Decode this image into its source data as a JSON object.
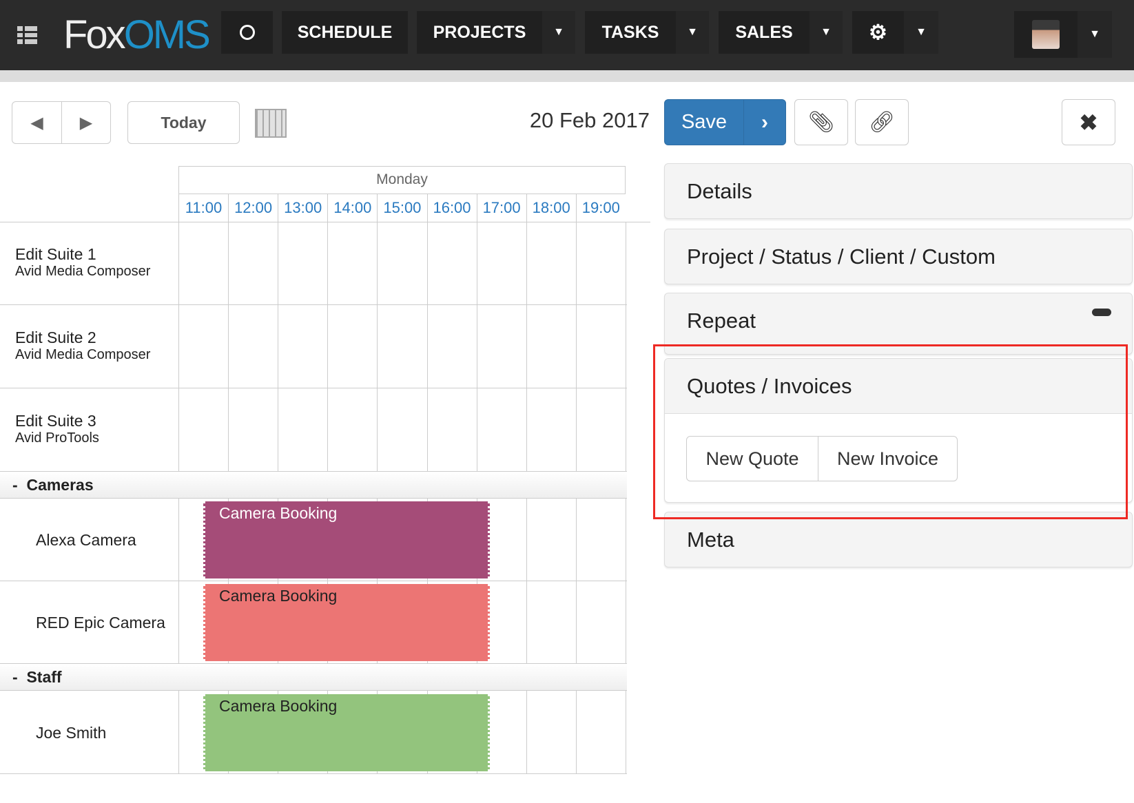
{
  "nav": {
    "brand_left": "Fox",
    "brand_right": "OMS",
    "items": [
      {
        "label": "SCHEDULE"
      },
      {
        "label": "PROJECTS"
      },
      {
        "label": "TASKS"
      },
      {
        "label": "SALES"
      }
    ],
    "colors": {
      "bar": "#2b2b2b",
      "brand_blue": "#1e90c8"
    }
  },
  "toolbar": {
    "today": "Today",
    "date": "20 Feb 2017",
    "save": "Save"
  },
  "calendar": {
    "day": "Monday",
    "hours": [
      "11:00",
      "12:00",
      "13:00",
      "14:00",
      "15:00",
      "16:00",
      "17:00",
      "18:00",
      "19:00"
    ],
    "rows": [
      {
        "name": "Edit Suite 1",
        "sub": "Avid Media Composer"
      },
      {
        "name": "Edit Suite 2",
        "sub": "Avid Media Composer"
      },
      {
        "name": "Edit Suite 3",
        "sub": "Avid ProTools"
      }
    ],
    "groups": [
      {
        "label": "Cameras",
        "toggle": "-",
        "rows": [
          {
            "name": "Alexa Camera"
          },
          {
            "name": "RED Epic Camera"
          }
        ]
      },
      {
        "label": "Staff",
        "toggle": "-",
        "rows": [
          {
            "name": "Joe Smith"
          }
        ]
      }
    ],
    "bookings": [
      {
        "title": "Camera Booking",
        "resource": "Alexa Camera",
        "color": "#a54c78",
        "text_color": "#ffffff"
      },
      {
        "title": "Camera Booking",
        "resource": "RED Epic Camera",
        "color": "#ec7574",
        "text_color": "#222222"
      },
      {
        "title": "Camera Booking",
        "resource": "Joe Smith",
        "color": "#93c47d",
        "text_color": "#222222"
      }
    ]
  },
  "panels": {
    "details": "Details",
    "project": "Project / Status / Client / Custom",
    "repeat": "Repeat",
    "quotes": "Quotes / Invoices",
    "new_quote": "New Quote",
    "new_invoice": "New Invoice",
    "meta": "Meta",
    "highlight_color": "#ee2a24"
  }
}
